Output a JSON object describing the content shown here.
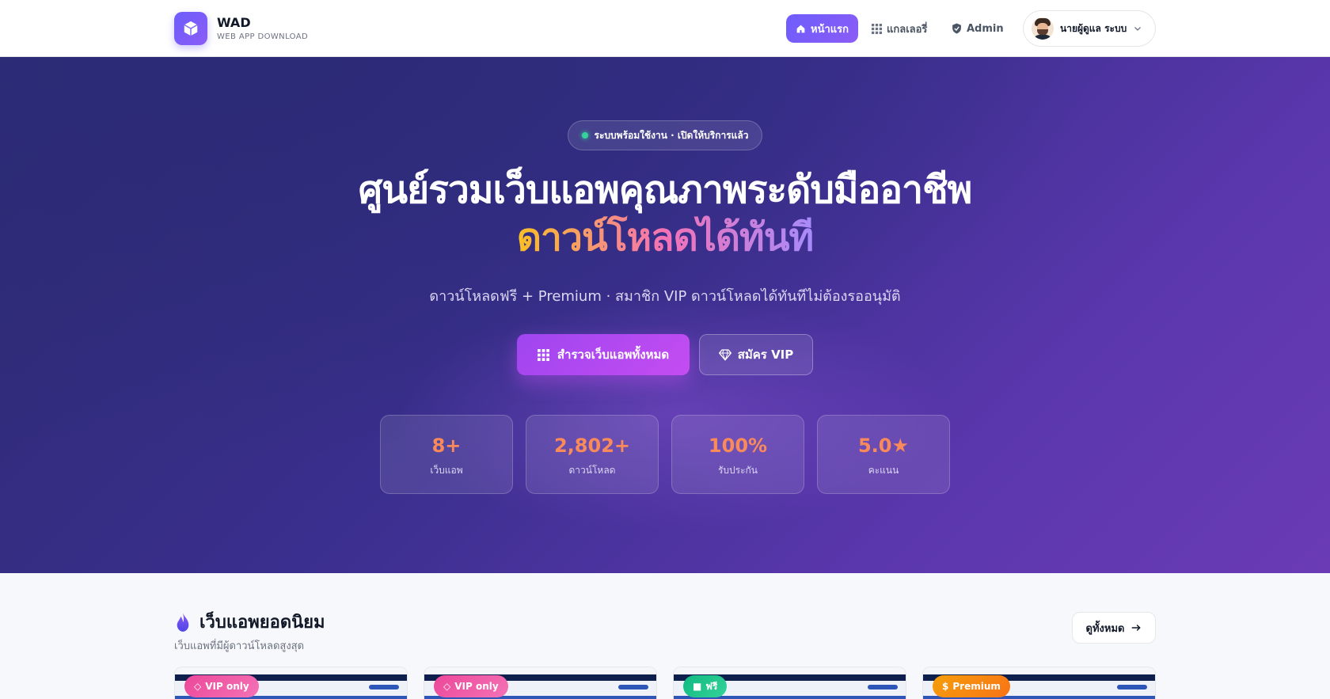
{
  "brand": {
    "name": "WAD",
    "tagline": "WEB APP DOWNLOAD"
  },
  "nav": {
    "home_label": "หน้าแรก",
    "gallery_label": "แกลเลอรี่",
    "admin_label": "Admin",
    "user_name": "นายผู้ดูแล ระบบ"
  },
  "hero": {
    "status": "ระบบพร้อมใช้งาน · เปิดให้บริการแล้ว",
    "title_line1": "ศูนย์รวมเว็บแอพคุณภาพระดับมืออาชีพ",
    "title_line2": "ดาวน์โหลดได้ทันที",
    "subtitle": "ดาวน์โหลดฟรี + Premium · สมาชิก VIP ดาวน์โหลดได้ทันทีไม่ต้องรออนุมัติ",
    "explore_label": "สำรวจเว็บแอพทั้งหมด",
    "vip_label": "สมัคร VIP"
  },
  "stats": [
    {
      "value": "8+",
      "label": "เว็บแอพ"
    },
    {
      "value": "2,802+",
      "label": "ดาวน์โหลด"
    },
    {
      "value": "100%",
      "label": "รับประกัน"
    },
    {
      "value": "5.0★",
      "label": "คะแนน"
    }
  ],
  "popular": {
    "title": "เว็บแอพยอดนิยม",
    "subtitle": "เว็บแอพที่มีผู้ดาวน์โหลดสูงสุด",
    "see_all_label": "ดูทั้งหมด",
    "cards": [
      {
        "badge": "VIP only",
        "badge_type": "vip"
      },
      {
        "badge": "VIP only",
        "badge_type": "vip"
      },
      {
        "badge": "ฟรี",
        "badge_type": "free"
      },
      {
        "badge": "Premium",
        "badge_type": "premium"
      }
    ]
  },
  "icons": {
    "logo": "box-icon",
    "home": "home-icon",
    "gallery": "grid-icon",
    "admin": "shield-icon",
    "user_menu": "chevron-down-icon",
    "vip": "diamond-icon",
    "section": "flame-icon",
    "see_all": "arrow-right-icon"
  },
  "colors": {
    "accent": "#6d5dfc",
    "hero_start": "#2b2a6f",
    "hero_end": "#6a3bb5",
    "stat_value": "#fb8a5a",
    "status_dot": "#34d399"
  }
}
